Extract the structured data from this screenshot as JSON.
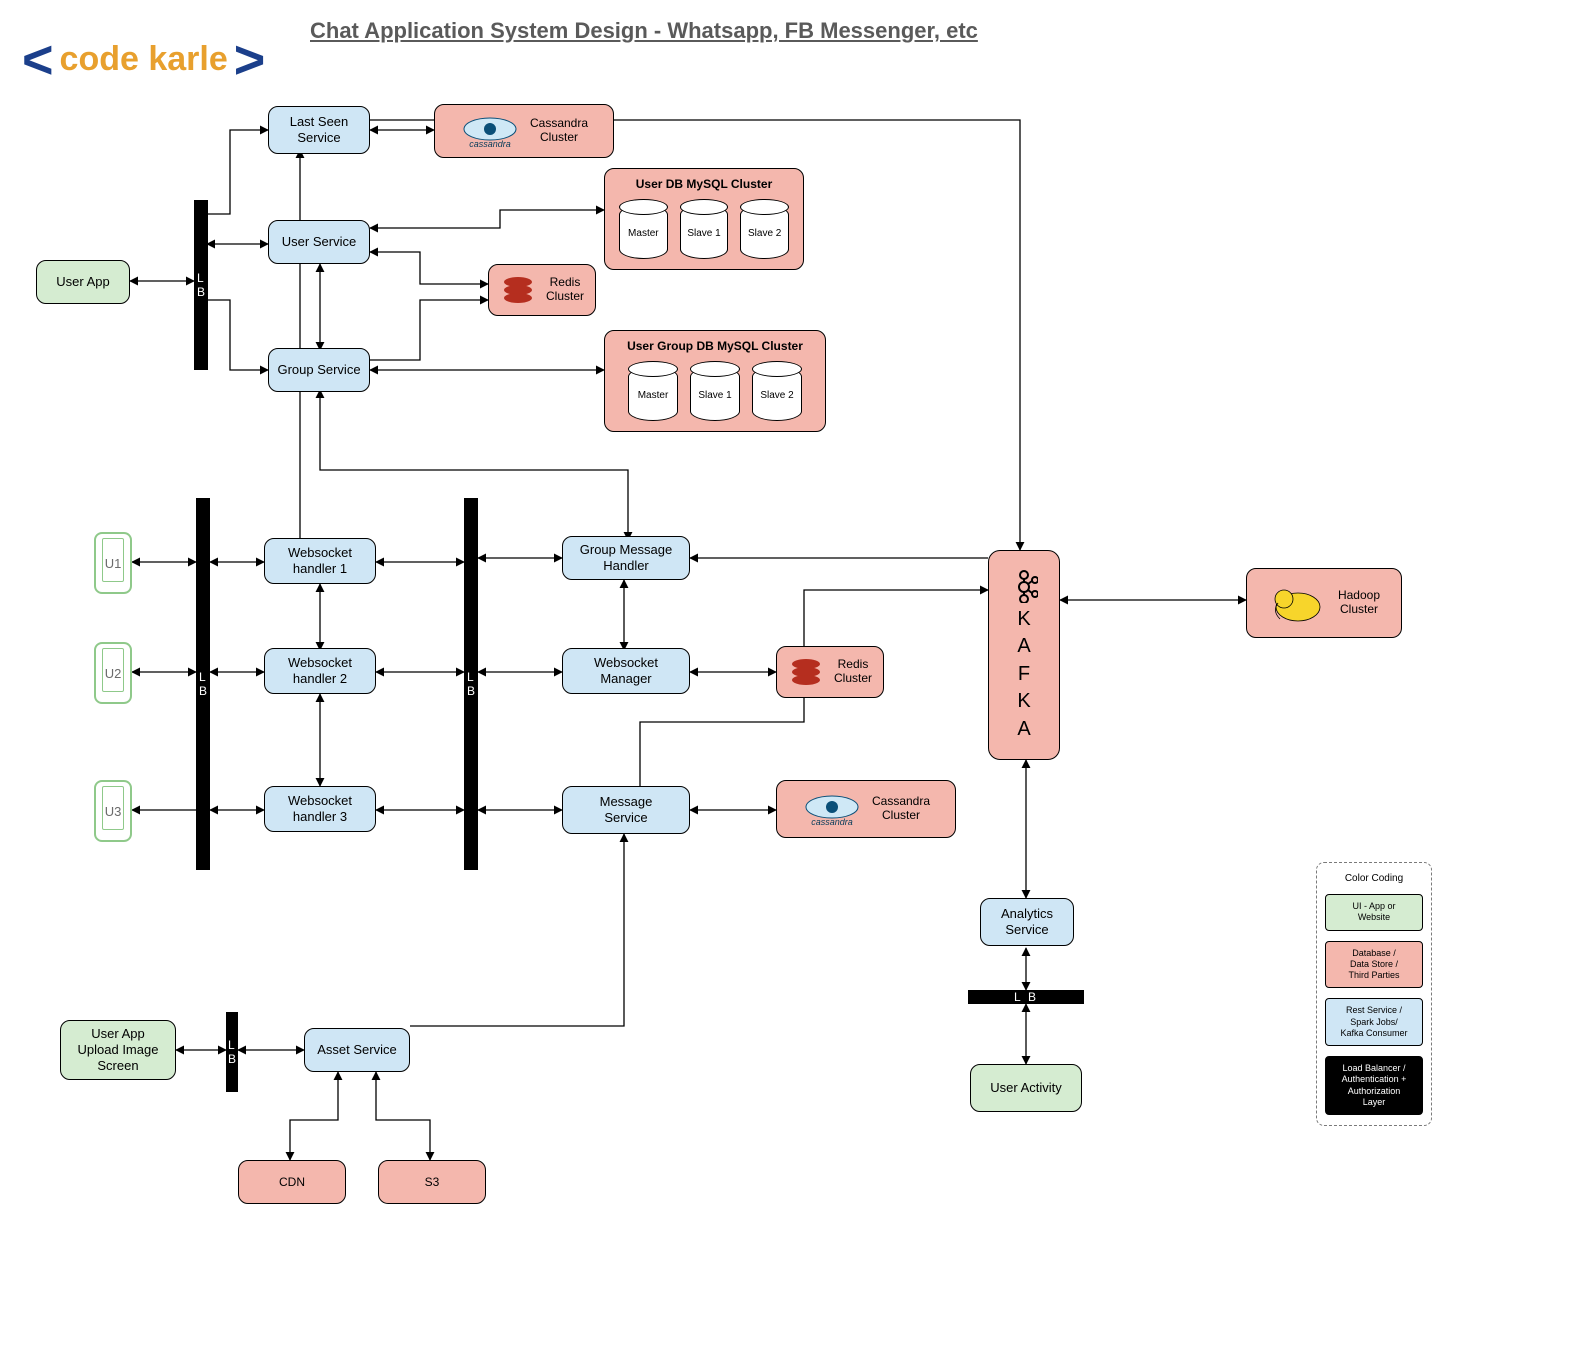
{
  "title": "Chat Application System Design - Whatsapp, FB Messenger, etc",
  "logo": {
    "left_ang": "<",
    "text": "code karle",
    "right_ang": ">"
  },
  "devices": {
    "u1": "U1",
    "u2": "U2",
    "u3": "U3"
  },
  "green": {
    "user_app": "User App",
    "upload": "User App\nUpload Image\nScreen",
    "user_activity": "User Activity"
  },
  "blue": {
    "last_seen": "Last Seen\nService",
    "user_service": "User Service",
    "group_service": "Group Service",
    "ws1": "Websocket\nhandler 1",
    "ws2": "Websocket\nhandler 2",
    "ws3": "Websocket\nhandler 3",
    "gmh": "Group Message\nHandler",
    "wsm": "Websocket\nManager",
    "msg": "Message\nService",
    "analytics": "Analytics\nService",
    "asset": "Asset Service"
  },
  "red": {
    "cassandra1": "Cassandra\nCluster",
    "redis1": "Redis\nCluster",
    "redis2": "Redis\nCluster",
    "cassandra2": "Cassandra\nCluster",
    "hadoop": "Hadoop\nCluster",
    "cdn": "CDN",
    "s3": "S3"
  },
  "clusters": {
    "userdb": {
      "title": "User DB MySQL Cluster",
      "c1": "Master",
      "c2": "Slave 1",
      "c3": "Slave 2"
    },
    "ugdb": {
      "title": "User Group DB MySQL Cluster",
      "c1": "Master",
      "c2": "Slave 1",
      "c3": "Slave 2"
    }
  },
  "lb": "L\nB",
  "kafka_letters": [
    "K",
    "A",
    "F",
    "K",
    "A"
  ],
  "legend": {
    "title": "Color Coding",
    "green": "UI - App or\nWebsite",
    "red": "Database /\nData Store /\nThird Parties",
    "blue": "Rest Service /\nSpark Jobs/\nKafka Consumer",
    "black": "Load Balancer /\nAuthentication +\nAuthorization\nLayer"
  },
  "icon_labels": {
    "cassandra_word": "cassandra"
  }
}
